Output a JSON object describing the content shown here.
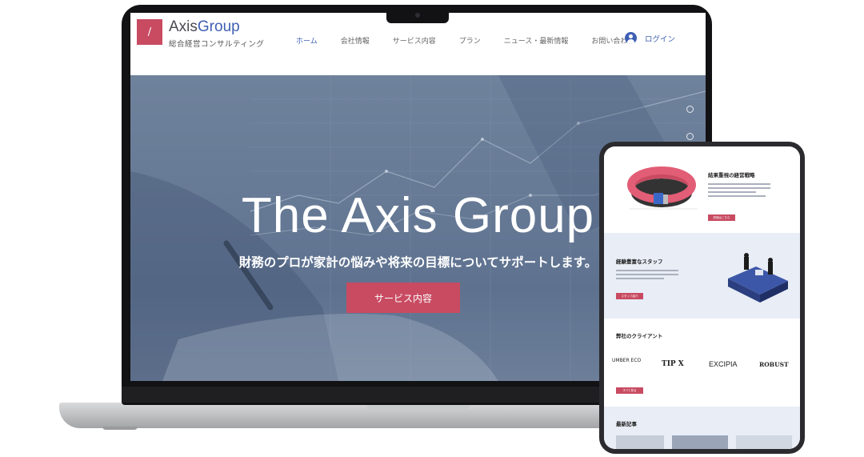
{
  "brand": {
    "logo_mark": "/",
    "name_prefix": "Axis",
    "name_suffix": "Group",
    "tagline": "総合経営コンサルティング",
    "accent": "#3f5fb3",
    "primary": "#c84b62"
  },
  "nav": {
    "items": [
      {
        "label": "ホーム",
        "active": true
      },
      {
        "label": "会社情報"
      },
      {
        "label": "サービス内容"
      },
      {
        "label": "プラン"
      },
      {
        "label": "ニュース・最新情報"
      },
      {
        "label": "お問い合わせ"
      }
    ],
    "login_label": "ログイン",
    "login_icon": "user-avatar-icon"
  },
  "hero": {
    "title": "The Axis Group",
    "subtitle": "財務のプロが家計の悩みや将来の目標についてサポートします。",
    "button_label": "サービス内容"
  },
  "mobile": {
    "section1": {
      "title": "結果重視の経営戦略",
      "button": "詳細はこちら"
    },
    "section2": {
      "title": "経験豊富なスタッフ",
      "button": "スタッフ紹介"
    },
    "section3": {
      "title": "弊社のクライアント",
      "clients": [
        "UMBER ECO",
        "TIP X",
        "EXCIPIA",
        "ROBUST"
      ],
      "button": "すべて見る"
    },
    "section4": {
      "title": "最新記事"
    }
  }
}
